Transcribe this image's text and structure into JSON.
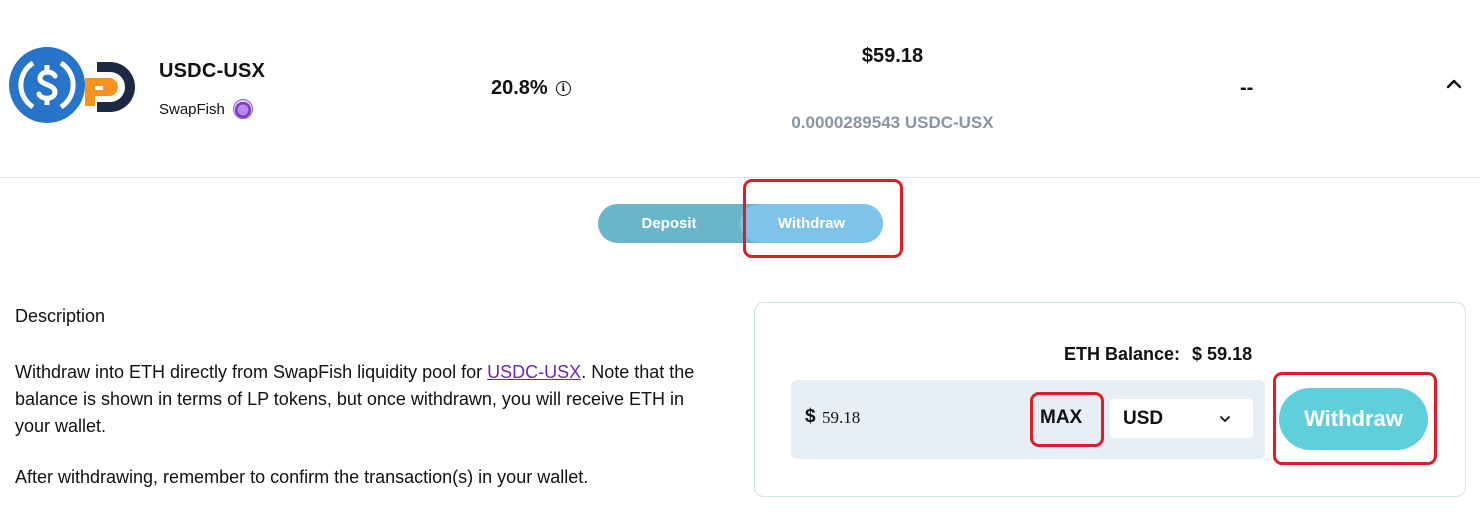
{
  "pool": {
    "name": "USDC-USX",
    "platform": "SwapFish",
    "apy": "20.8%",
    "deposit_usd": "$59.18",
    "deposit_lp": "0.0000289543 USDC-USX",
    "daily": "--"
  },
  "tabs": {
    "deposit": "Deposit",
    "withdraw": "Withdraw",
    "active": "Withdraw"
  },
  "description": {
    "title": "Description",
    "line_prefix": "Withdraw into ETH directly from SwapFish liquidity pool for ",
    "link": "USDC-USX",
    "line_suffix": ". Note that the balance is shown in terms of LP tokens, but once withdrawn, you will receive ETH in your wallet.",
    "after": "After withdrawing, remember to confirm the transaction(s) in your wallet."
  },
  "withdraw_panel": {
    "balance_label": "ETH Balance:",
    "balance_value": "$ 59.18",
    "currency_symbol": "$",
    "amount": "59.18",
    "max_label": "MAX",
    "currency": "USD",
    "button": "Withdraw"
  },
  "icons": {
    "token": "usdc-icon",
    "protocol": "dforce-d-icon",
    "platform": "swapfish-icon",
    "info": "info-icon",
    "collapse": "chevron-up-icon",
    "dropdown": "chevron-down-icon"
  },
  "colors": {
    "usdc_blue": "#2775ca",
    "toggle_bg": "#6ab6c8",
    "toggle_active": "#7ec3ea",
    "withdraw_button": "#5fcfdc",
    "input_bg": "#e7eff5",
    "annotation_red": "#e01b2a",
    "link": "#6b2aa3"
  }
}
